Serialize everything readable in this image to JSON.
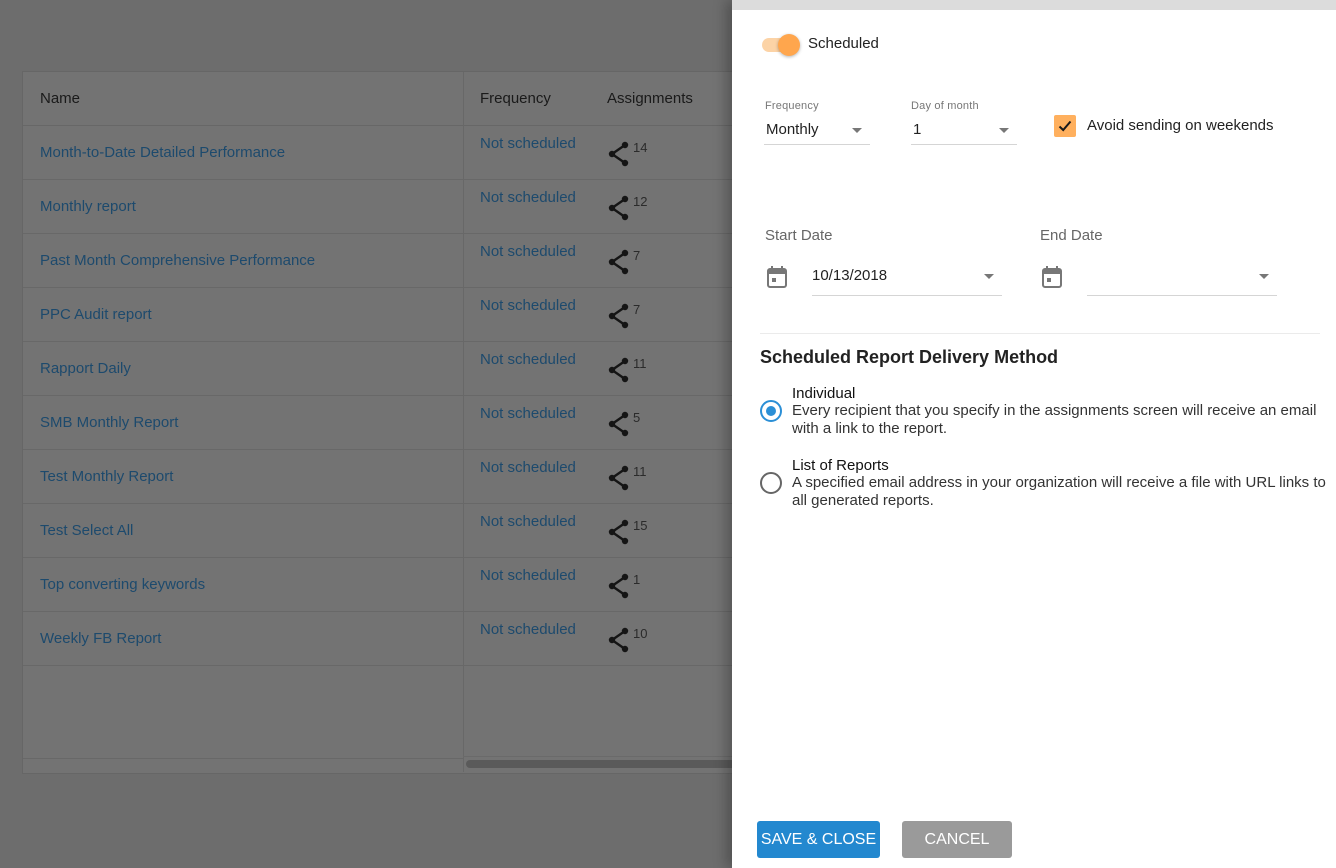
{
  "table": {
    "columns": [
      "Name",
      "Frequency",
      "Assignments"
    ],
    "rows": [
      {
        "name": "Month-to-Date Detailed Performance",
        "frequency": "Not scheduled",
        "assignments": "14"
      },
      {
        "name": "Monthly report",
        "frequency": "Not scheduled",
        "assignments": "12"
      },
      {
        "name": "Past Month Comprehensive Performance",
        "frequency": "Not scheduled",
        "assignments": "7"
      },
      {
        "name": "PPC Audit report",
        "frequency": "Not scheduled",
        "assignments": "7"
      },
      {
        "name": "Rapport Daily",
        "frequency": "Not scheduled",
        "assignments": "11"
      },
      {
        "name": "SMB Monthly Report",
        "frequency": "Not scheduled",
        "assignments": "5"
      },
      {
        "name": "Test Monthly Report",
        "frequency": "Not scheduled",
        "assignments": "11"
      },
      {
        "name": "Test Select All",
        "frequency": "Not scheduled",
        "assignments": "15"
      },
      {
        "name": "Top converting keywords",
        "frequency": "Not scheduled",
        "assignments": "1"
      },
      {
        "name": "Weekly FB Report",
        "frequency": "Not scheduled",
        "assignments": "10"
      }
    ]
  },
  "panel": {
    "toggle": {
      "label": "Scheduled",
      "on": true
    },
    "frequency": {
      "label": "Frequency",
      "value": "Monthly"
    },
    "day_of_month": {
      "label": "Day of month",
      "value": "1"
    },
    "avoid_weekends": {
      "label": "Avoid sending on weekends",
      "checked": true
    },
    "start_date": {
      "label": "Start Date",
      "value": "10/13/2018"
    },
    "end_date": {
      "label": "End Date",
      "value": ""
    },
    "delivery": {
      "title": "Scheduled Report Delivery Method",
      "options": [
        {
          "title": "Individual",
          "description": "Every recipient that you specify in the assignments screen will receive an email with a link to the report.",
          "selected": true
        },
        {
          "title": "List of Reports",
          "description": "A specified email address in your organization will receive a file with URL links to all generated reports.",
          "selected": false
        }
      ]
    },
    "buttons": {
      "save": "SAVE & CLOSE",
      "cancel": "CANCEL"
    }
  },
  "colors": {
    "accent_orange": "#ffa64d",
    "primary_blue": "#2388cf",
    "cancel_gray": "#9a9a9a",
    "link_blue": "#1d4a6d"
  }
}
